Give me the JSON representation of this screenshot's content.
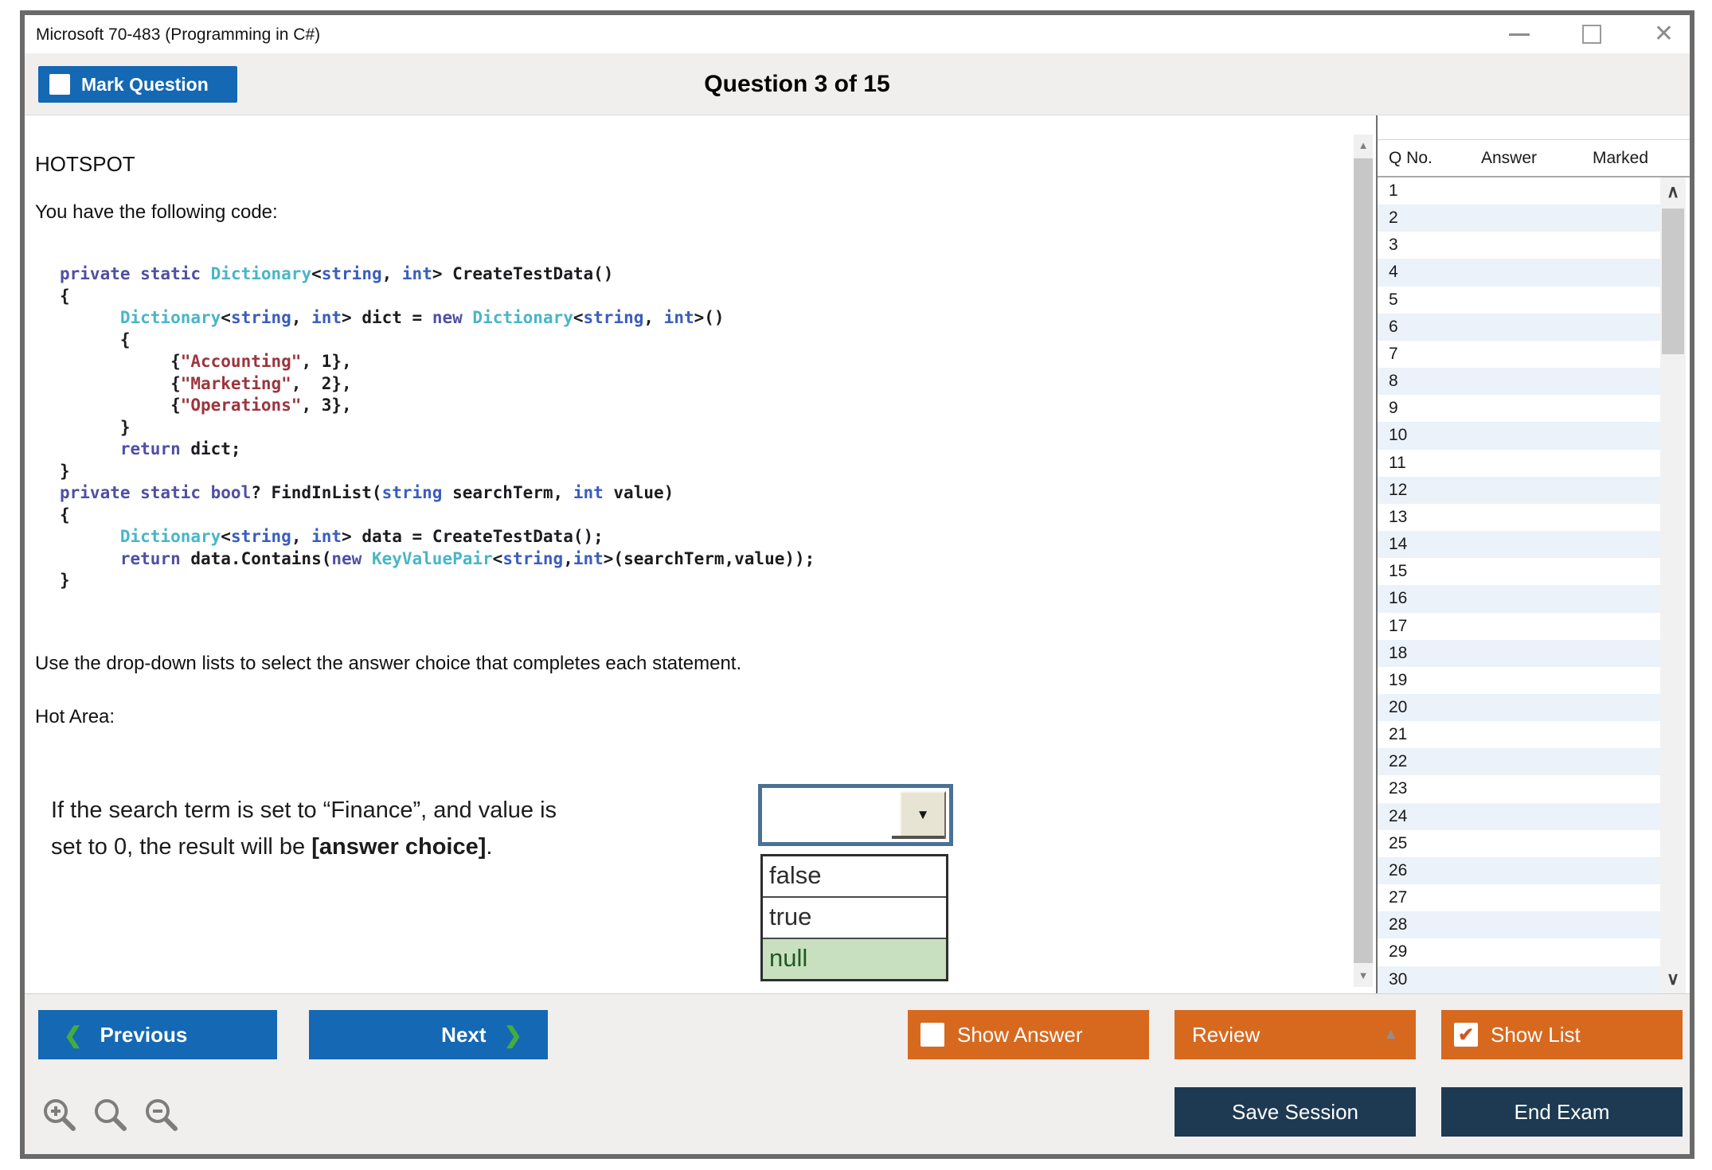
{
  "window": {
    "title": "Microsoft 70-483 (Programming in C#)"
  },
  "header": {
    "mark_question_label": "Mark Question",
    "mark_question_checked": false,
    "question_counter": "Question 3 of 15"
  },
  "question": {
    "type_label": "HOTSPOT",
    "intro": "You have the following code:",
    "instruction": "Use the drop-down lists to select the answer choice that completes each statement.",
    "hot_area_label": "Hot Area:",
    "statement": {
      "line1": "If the search term is set to “Finance”, and value is",
      "line2_prefix": "set to 0, the result will be ",
      "line2_bold": "[answer choice]",
      "line2_suffix": "."
    },
    "dropdown": {
      "selected_value": "",
      "options": [
        "false",
        "true",
        "null"
      ],
      "highlighted_option": "null"
    }
  },
  "code": {
    "lines": [
      [
        {
          "t": "private static ",
          "c": "k"
        },
        {
          "t": "Dictionary",
          "c": "t"
        },
        {
          "t": "<",
          "c": "p"
        },
        {
          "t": "string",
          "c": "b"
        },
        {
          "t": ", ",
          "c": "p"
        },
        {
          "t": "int",
          "c": "b"
        },
        {
          "t": "> CreateTestData()",
          "c": "p"
        }
      ],
      [
        {
          "t": "{",
          "c": "p"
        }
      ],
      [
        {
          "t": "      ",
          "c": "p"
        },
        {
          "t": "Dictionary",
          "c": "t"
        },
        {
          "t": "<",
          "c": "p"
        },
        {
          "t": "string",
          "c": "b"
        },
        {
          "t": ", ",
          "c": "p"
        },
        {
          "t": "int",
          "c": "b"
        },
        {
          "t": "> dict = ",
          "c": "p"
        },
        {
          "t": "new ",
          "c": "k"
        },
        {
          "t": "Dictionary",
          "c": "t"
        },
        {
          "t": "<",
          "c": "p"
        },
        {
          "t": "string",
          "c": "b"
        },
        {
          "t": ", ",
          "c": "p"
        },
        {
          "t": "int",
          "c": "b"
        },
        {
          "t": ">()",
          "c": "p"
        }
      ],
      [
        {
          "t": "      {",
          "c": "p"
        }
      ],
      [
        {
          "t": "           {",
          "c": "p"
        },
        {
          "t": "\"Accounting\"",
          "c": "s"
        },
        {
          "t": ", 1},",
          "c": "p"
        }
      ],
      [
        {
          "t": "           {",
          "c": "p"
        },
        {
          "t": "\"Marketing\"",
          "c": "s"
        },
        {
          "t": ",  2},",
          "c": "p"
        }
      ],
      [
        {
          "t": "           {",
          "c": "p"
        },
        {
          "t": "\"Operations\"",
          "c": "s"
        },
        {
          "t": ", 3},",
          "c": "p"
        }
      ],
      [
        {
          "t": "      }",
          "c": "p"
        }
      ],
      [
        {
          "t": "      ",
          "c": "p"
        },
        {
          "t": "return",
          "c": "k"
        },
        {
          "t": " dict;",
          "c": "p"
        }
      ],
      [
        {
          "t": "}",
          "c": "p"
        }
      ],
      [
        {
          "t": "private static bool",
          "c": "k"
        },
        {
          "t": "? FindInList(",
          "c": "p"
        },
        {
          "t": "string",
          "c": "b"
        },
        {
          "t": " searchTerm, ",
          "c": "p"
        },
        {
          "t": "int",
          "c": "b"
        },
        {
          "t": " value)",
          "c": "p"
        }
      ],
      [
        {
          "t": "{",
          "c": "p"
        }
      ],
      [
        {
          "t": "      ",
          "c": "p"
        },
        {
          "t": "Dictionary",
          "c": "t"
        },
        {
          "t": "<",
          "c": "p"
        },
        {
          "t": "string",
          "c": "b"
        },
        {
          "t": ", ",
          "c": "p"
        },
        {
          "t": "int",
          "c": "b"
        },
        {
          "t": "> data = CreateTestData();",
          "c": "p"
        }
      ],
      [
        {
          "t": "      ",
          "c": "p"
        },
        {
          "t": "return",
          "c": "k"
        },
        {
          "t": " data.Contains(",
          "c": "p"
        },
        {
          "t": "new ",
          "c": "k"
        },
        {
          "t": "KeyValuePair",
          "c": "t"
        },
        {
          "t": "<",
          "c": "p"
        },
        {
          "t": "string",
          "c": "b"
        },
        {
          "t": ",",
          "c": "p"
        },
        {
          "t": "int",
          "c": "b"
        },
        {
          "t": ">(searchTerm,value));",
          "c": "p"
        }
      ],
      [
        {
          "t": "}",
          "c": "p"
        }
      ]
    ]
  },
  "question_list": {
    "columns": [
      "Q No.",
      "Answer",
      "Marked"
    ],
    "rows": [
      {
        "q": "1",
        "answer": "",
        "marked": ""
      },
      {
        "q": "2",
        "answer": "",
        "marked": ""
      },
      {
        "q": "3",
        "answer": "",
        "marked": ""
      },
      {
        "q": "4",
        "answer": "",
        "marked": ""
      },
      {
        "q": "5",
        "answer": "",
        "marked": ""
      },
      {
        "q": "6",
        "answer": "",
        "marked": ""
      },
      {
        "q": "7",
        "answer": "",
        "marked": ""
      },
      {
        "q": "8",
        "answer": "",
        "marked": ""
      },
      {
        "q": "9",
        "answer": "",
        "marked": ""
      },
      {
        "q": "10",
        "answer": "",
        "marked": ""
      },
      {
        "q": "11",
        "answer": "",
        "marked": ""
      },
      {
        "q": "12",
        "answer": "",
        "marked": ""
      },
      {
        "q": "13",
        "answer": "",
        "marked": ""
      },
      {
        "q": "14",
        "answer": "",
        "marked": ""
      },
      {
        "q": "15",
        "answer": "",
        "marked": ""
      },
      {
        "q": "16",
        "answer": "",
        "marked": ""
      },
      {
        "q": "17",
        "answer": "",
        "marked": ""
      },
      {
        "q": "18",
        "answer": "",
        "marked": ""
      },
      {
        "q": "19",
        "answer": "",
        "marked": ""
      },
      {
        "q": "20",
        "answer": "",
        "marked": ""
      },
      {
        "q": "21",
        "answer": "",
        "marked": ""
      },
      {
        "q": "22",
        "answer": "",
        "marked": ""
      },
      {
        "q": "23",
        "answer": "",
        "marked": ""
      },
      {
        "q": "24",
        "answer": "",
        "marked": ""
      },
      {
        "q": "25",
        "answer": "",
        "marked": ""
      },
      {
        "q": "26",
        "answer": "",
        "marked": ""
      },
      {
        "q": "27",
        "answer": "",
        "marked": ""
      },
      {
        "q": "28",
        "answer": "",
        "marked": ""
      },
      {
        "q": "29",
        "answer": "",
        "marked": ""
      },
      {
        "q": "30",
        "answer": "",
        "marked": ""
      }
    ]
  },
  "footer": {
    "previous_label": "Previous",
    "next_label": "Next",
    "show_answer_label": "Show Answer",
    "show_answer_checked": false,
    "review_label": "Review",
    "show_list_label": "Show List",
    "show_list_checked": true,
    "save_session_label": "Save Session",
    "end_exam_label": "End Exam"
  },
  "icons": {
    "close": "✕",
    "dropdown_arrow": "▼",
    "collapse_arrow": "▲",
    "chevron_left": "❮",
    "chevron_right": "❯",
    "check": "✔",
    "triangle_up": "▲",
    "triangle_down": "▼",
    "chevron_up": "∧",
    "chevron_down": "∨"
  },
  "colors": {
    "accent_blue": "#1568b3",
    "accent_orange": "#d7691f",
    "dark_navy": "#1d3a52",
    "chevron_green": "#43ad3f",
    "option_highlight_green": "#c8e0c0",
    "row_alt_blue": "#ebf2f9"
  }
}
